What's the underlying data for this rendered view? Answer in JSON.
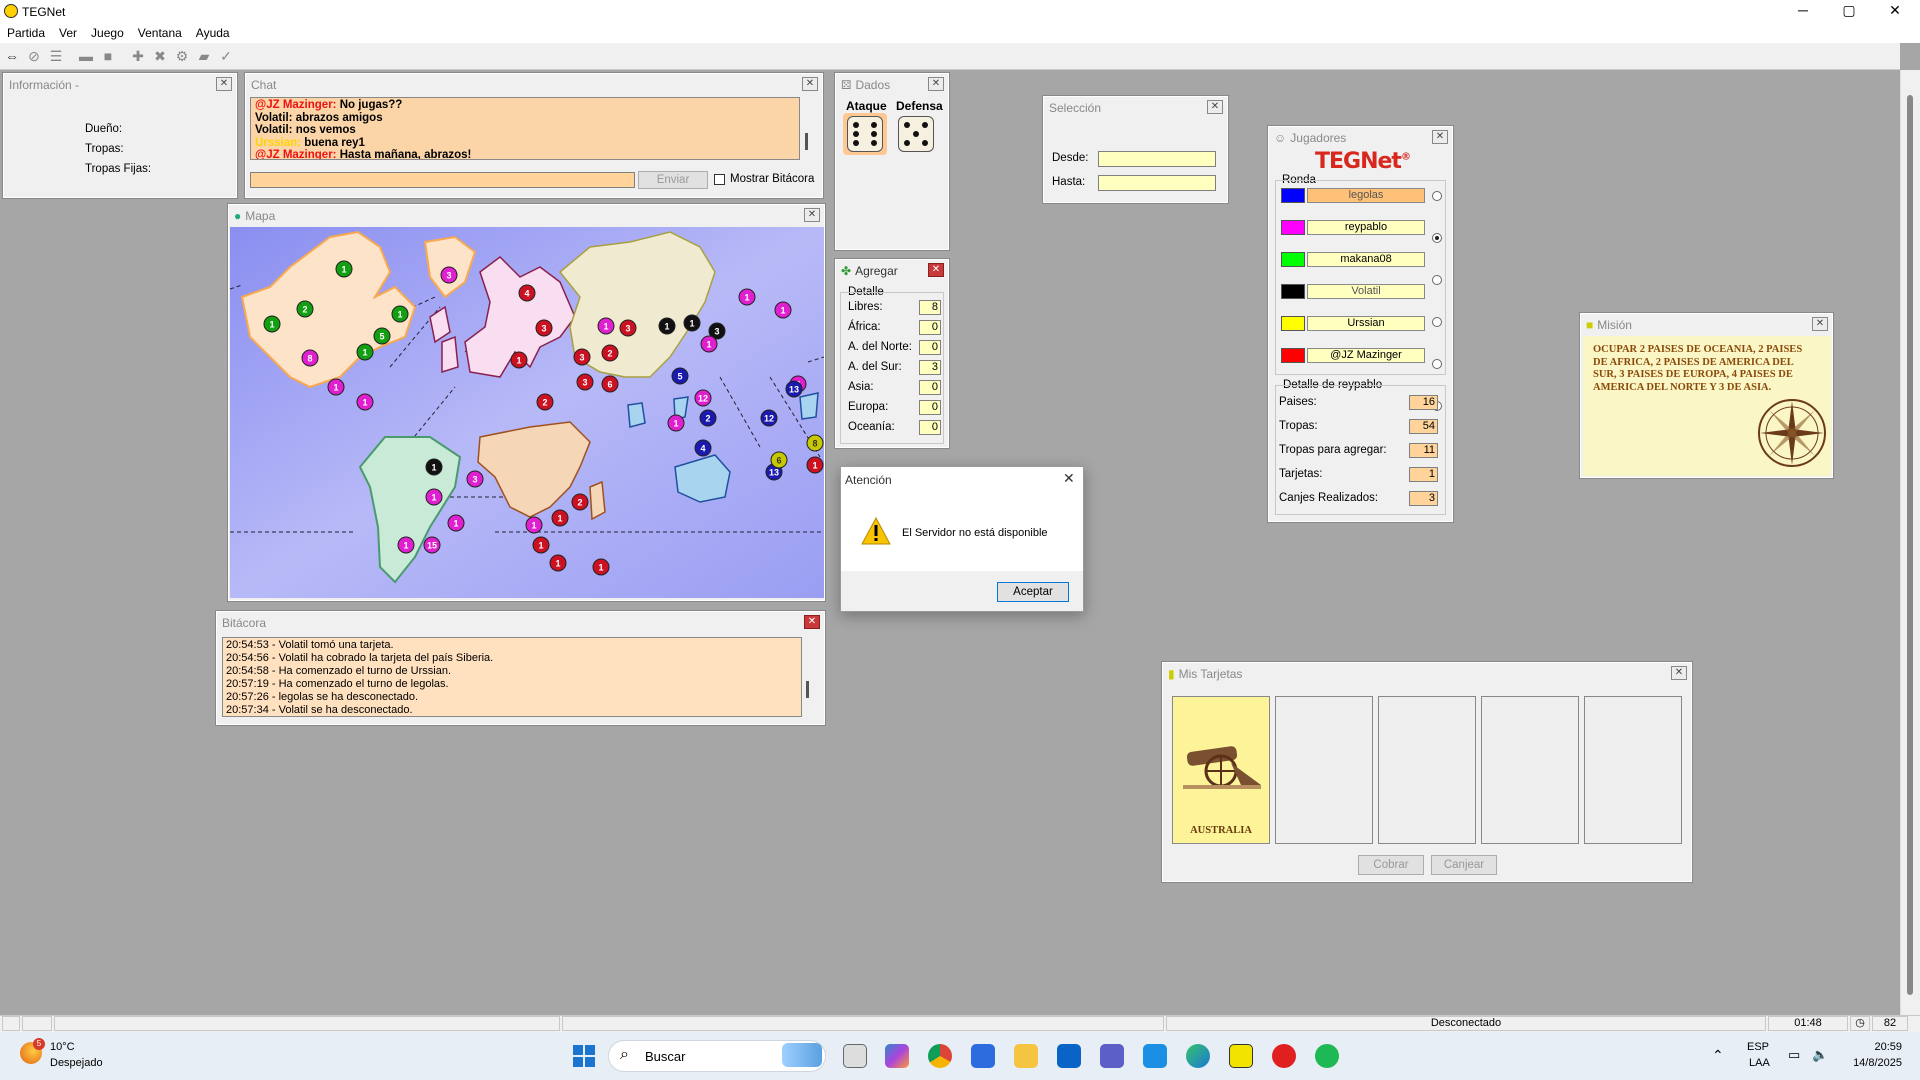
{
  "window": {
    "title": "TEGNet",
    "minimize": "─",
    "maximize": "▢",
    "close": "✕"
  },
  "menu": [
    "Partida",
    "Ver",
    "Juego",
    "Ventana",
    "Ayuda"
  ],
  "info_panel": {
    "title": "Información -",
    "owner_label": "Dueño:",
    "troops_label": "Tropas:",
    "fixed_troops_label": "Tropas Fijas:"
  },
  "chat": {
    "title": "Chat",
    "lines": [
      {
        "name": "@JZ Mazinger:",
        "name_color": "#ee1111",
        "text": "No jugas??"
      },
      {
        "name": "Volatil:",
        "name_color": "#000000",
        "text": "abrazos amigos"
      },
      {
        "name": "Volatil:",
        "name_color": "#000000",
        "text": "nos vemos"
      },
      {
        "name": "Urssian:",
        "name_color": "#ffd200",
        "text": "buena rey1"
      },
      {
        "name": "@JZ Mazinger:",
        "name_color": "#ee1111",
        "text": "Hasta mañana, abrazos!"
      }
    ],
    "send_button": "Enviar",
    "show_log_label": "Mostrar Bitácora"
  },
  "dice": {
    "title": "Dados",
    "attack_label": "Ataque",
    "defense_label": "Defensa",
    "attack_value": 6,
    "defense_value": 5
  },
  "selection": {
    "title": "Selección",
    "from_label": "Desde:",
    "to_label": "Hasta:",
    "from_value": "",
    "to_value": ""
  },
  "players": {
    "title": "Jugadores",
    "logo": "TEGNet",
    "logo_mark": "®",
    "round_label": "Ronda",
    "list": [
      {
        "name": "legolas",
        "color": "#0000ff",
        "active": false,
        "highlight": true
      },
      {
        "name": "reypablo",
        "color": "#ff00ff",
        "active": true,
        "highlight": false
      },
      {
        "name": "makana08",
        "color": "#00ff00",
        "active": false,
        "highlight": false
      },
      {
        "name": "Volatil",
        "color": "#000000",
        "active": false,
        "highlight": false
      },
      {
        "name": "Urssian",
        "color": "#ffff00",
        "active": false,
        "highlight": false
      },
      {
        "name": "@JZ Mazinger",
        "color": "#ff0000",
        "active": false,
        "highlight": false
      }
    ],
    "detail_title": "Detalle de reypablo",
    "stats": [
      {
        "label": "Paises:",
        "value": "16"
      },
      {
        "label": "Tropas:",
        "value": "54"
      },
      {
        "label": "Tropas para agregar:",
        "value": "11"
      },
      {
        "label": "Tarjetas:",
        "value": "1"
      },
      {
        "label": "Canjes Realizados:",
        "value": "3"
      }
    ]
  },
  "map": {
    "title": "Mapa"
  },
  "add": {
    "title": "Agregar",
    "detail_label": "Detalle",
    "rows": [
      {
        "label": "Libres:",
        "value": "8"
      },
      {
        "label": "África:",
        "value": "0"
      },
      {
        "label": "A. del Norte:",
        "value": "0"
      },
      {
        "label": "A. del Sur:",
        "value": "3"
      },
      {
        "label": "Asia:",
        "value": "0"
      },
      {
        "label": "Europa:",
        "value": "0"
      },
      {
        "label": "Oceanía:",
        "value": "0"
      }
    ]
  },
  "mission": {
    "title": "Misión",
    "text": "OCUPAR 2 PAISES DE OCEANIA, 2 PAISES DE AFRICA, 2 PAISES DE AMERICA DEL SUR, 3 PAISES DE EUROPA, 4 PAISES DE AMERICA DEL NORTE Y 3 DE ASIA."
  },
  "alert": {
    "title": "Atención",
    "message": "El Servidor no está disponible",
    "ok": "Aceptar"
  },
  "log": {
    "title": "Bitácora",
    "lines": [
      "20:54:53 - Volatil tomó una tarjeta.",
      "20:54:56 - Volatil ha cobrado la tarjeta del país Siberia.",
      "20:54:58 - Ha comenzado el turno de Urssian.",
      "20:57:19 - Ha comenzado el turno de legolas.",
      "20:57:26 - legolas se ha desconectado.",
      "20:57:34 - Volatil se ha desconectado."
    ]
  },
  "cards": {
    "title": "Mis Tarjetas",
    "card1_name": "AUSTRALIA",
    "collect": "Cobrar",
    "exchange": "Canjear"
  },
  "status": {
    "state": "Desconectado",
    "time": "01:48",
    "count": "82"
  },
  "taskbar": {
    "weather_temp": "10°C",
    "weather_text": "Despejado",
    "weather_badge": "5",
    "search": "Buscar",
    "lang1": "ESP",
    "lang2": "LAA",
    "clock_time": "20:59",
    "clock_date": "14/8/2025"
  },
  "map_tokens": [
    {
      "n": "1",
      "c": "#12a012"
    },
    {
      "n": "2",
      "c": "#12a012"
    },
    {
      "n": "1",
      "c": "#12a012"
    },
    {
      "n": "1",
      "c": "#12a012"
    },
    {
      "n": "1",
      "c": "#12a012"
    },
    {
      "n": "5",
      "c": "#12a012"
    },
    {
      "n": "3",
      "c": "#e020d0"
    },
    {
      "n": "8",
      "c": "#e020d0"
    },
    {
      "n": "1",
      "c": "#e020d0"
    },
    {
      "n": "1",
      "c": "#e020d0"
    },
    {
      "n": "4",
      "c": "#cc1122"
    },
    {
      "n": "3",
      "c": "#cc1122"
    },
    {
      "n": "1",
      "c": "#cc1122"
    },
    {
      "n": "3",
      "c": "#cc1122"
    },
    {
      "n": "3",
      "c": "#cc1122"
    },
    {
      "n": "2",
      "c": "#cc1122"
    },
    {
      "n": "3",
      "c": "#cc1122"
    },
    {
      "n": "2",
      "c": "#cc1122"
    },
    {
      "n": "6",
      "c": "#cc1122"
    },
    {
      "n": "1",
      "c": "#e020d0"
    },
    {
      "n": "1",
      "c": "#111111"
    },
    {
      "n": "1",
      "c": "#111111"
    },
    {
      "n": "3",
      "c": "#111111"
    },
    {
      "n": "1",
      "c": "#e020d0"
    },
    {
      "n": "1",
      "c": "#e020d0"
    },
    {
      "n": "1",
      "c": "#e020d0"
    },
    {
      "n": "3",
      "c": "#e020d0"
    },
    {
      "n": "12",
      "c": "#e020d0"
    },
    {
      "n": "5",
      "c": "#1a1ab0"
    },
    {
      "n": "1",
      "c": "#e020d0"
    },
    {
      "n": "2",
      "c": "#1a1ab0"
    },
    {
      "n": "4",
      "c": "#1a1ab0"
    },
    {
      "n": "12",
      "c": "#1a1ab0"
    },
    {
      "n": "13",
      "c": "#1a1ab0"
    },
    {
      "n": "1",
      "c": "#111111"
    },
    {
      "n": "3",
      "c": "#e020d0"
    },
    {
      "n": "1",
      "c": "#e020d0"
    },
    {
      "n": "1",
      "c": "#e020d0"
    },
    {
      "n": "1",
      "c": "#e020d0"
    },
    {
      "n": "15",
      "c": "#e020d0"
    },
    {
      "n": "1",
      "c": "#e020d0"
    },
    {
      "n": "2",
      "c": "#cc1122"
    },
    {
      "n": "1",
      "c": "#cc1122"
    },
    {
      "n": "1",
      "c": "#cc1122"
    },
    {
      "n": "1",
      "c": "#cc1122"
    },
    {
      "n": "1",
      "c": "#cc1122"
    },
    {
      "n": "1",
      "c": "#cc1122"
    },
    {
      "n": "8",
      "c": "#c8c800"
    },
    {
      "n": "13",
      "c": "#1a1ab0"
    },
    {
      "n": "6",
      "c": "#c8c800"
    },
    {
      "n": "11",
      "c": "#c8c800"
    }
  ]
}
